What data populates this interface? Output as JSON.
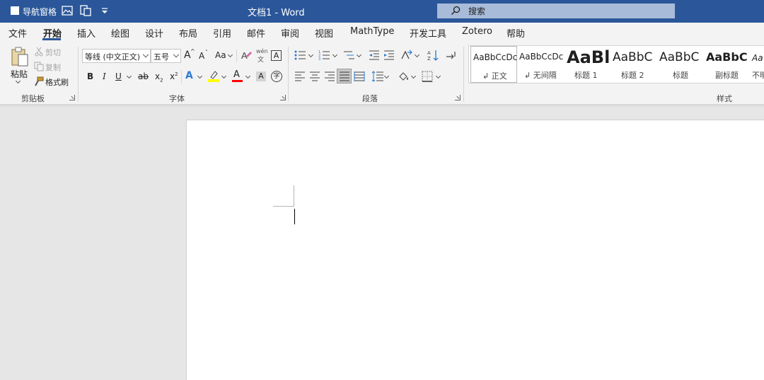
{
  "titlebar": {
    "nav_pane_label": "导航窗格",
    "doc_title": "文档1  -  Word",
    "search_placeholder": "搜索",
    "bg_color": "#2b579a"
  },
  "tabs": [
    "文件",
    "开始",
    "插入",
    "绘图",
    "设计",
    "布局",
    "引用",
    "邮件",
    "审阅",
    "视图",
    "MathType",
    "开发工具",
    "Zotero",
    "帮助"
  ],
  "active_tab": "开始",
  "clipboard": {
    "paste": "粘贴",
    "cut": "剪切",
    "copy": "复制",
    "format_painter": "格式刷",
    "group": "剪贴板"
  },
  "font": {
    "name": "等线 (中文正文)",
    "size": "五号",
    "group": "字体",
    "change_case": "Aa",
    "phonetic": "wén",
    "phonetic_sub": "文",
    "bold": "B",
    "italic": "I",
    "underline": "U",
    "strike": "ab",
    "subscript": "x",
    "subscript_sub": "2",
    "superscript": "x",
    "superscript_sup": "2",
    "grow": "A",
    "shrink": "A",
    "effects": "A",
    "font_color": "A",
    "char_shading": "A",
    "char_border": "A",
    "enclose": "字",
    "highlight_color": "#ffff00",
    "font_color_value": "#ff0000"
  },
  "paragraph": {
    "group": "段落"
  },
  "styles": {
    "group": "样式",
    "items": [
      {
        "preview": "AaBbCcDc",
        "name": "↲ 正文"
      },
      {
        "preview": "AaBbCcDc",
        "name": "↲ 无间隔"
      },
      {
        "preview": "AaBl",
        "name": "标题 1"
      },
      {
        "preview": "AaBbC",
        "name": "标题 2"
      },
      {
        "preview": "AaBbC",
        "name": "标题"
      },
      {
        "preview": "AaBbC",
        "name": "副标题"
      },
      {
        "preview": "Aa",
        "name": "不明"
      }
    ]
  }
}
